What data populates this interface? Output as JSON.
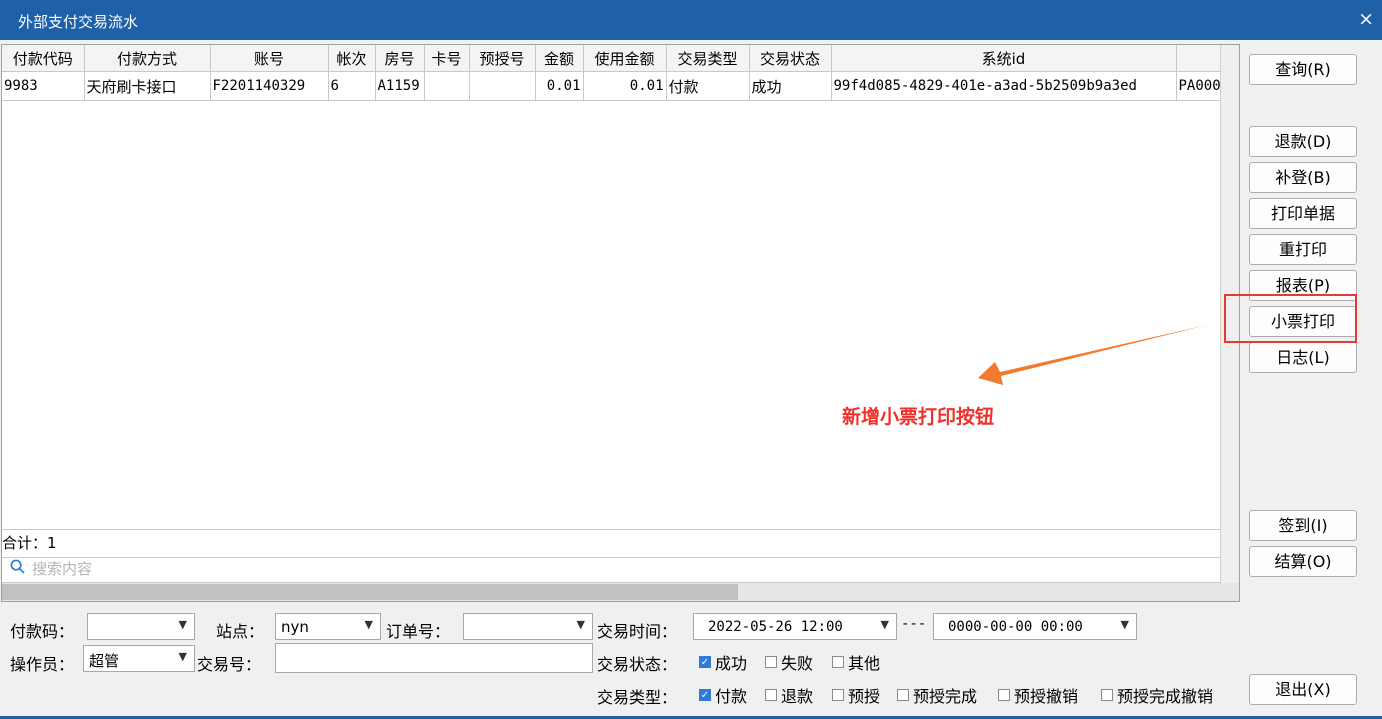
{
  "window": {
    "title": "外部支付交易流水",
    "close_glyph": "×"
  },
  "table": {
    "columns": [
      "付款代码",
      "付款方式",
      "账号",
      "帐次",
      "房号",
      "卡号",
      "预授号",
      "金额",
      "使用金额",
      "交易类型",
      "交易状态",
      "系统id",
      ""
    ],
    "rows": [
      [
        "9983",
        "天府刷卡接口",
        "F2201140329",
        "6",
        "A1159",
        "",
        "",
        "0.01",
        "0.01",
        "付款",
        "成功",
        "99f4d085-4829-401e-a3ad-5b2509b9a3ed",
        "PA000"
      ]
    ],
    "total_label": "合计：1",
    "search_placeholder": "搜索内容",
    "search_icon": "search-icon"
  },
  "buttons": {
    "query": "查询(R)",
    "refund": "退款(D)",
    "supplement": "补登(B)",
    "print_receipt": "打印单据",
    "reprint": "重打印",
    "report": "报表(P)",
    "ticket_print": "小票打印",
    "log": "日志(L)",
    "sign_in": "签到(I)",
    "settle": "结算(O)",
    "exit": "退出(X)"
  },
  "annotation": {
    "text": "新增小票打印按钮",
    "color": "#f0312b"
  },
  "filters": {
    "pay_code_label": "付款码：",
    "pay_code_value": "",
    "station_label": "站点：",
    "station_value": "nyn",
    "order_label": "订单号：",
    "order_value": "",
    "time_label": "交易时间：",
    "time_from": "2022-05-26 12:00",
    "time_sep": "---",
    "time_to": "0000-00-00 00:00",
    "operator_label": "操作员：",
    "operator_value": "超管",
    "trans_no_label": "交易号：",
    "trans_no_value": "",
    "status_label": "交易状态：",
    "status_options": [
      {
        "label": "成功",
        "checked": true
      },
      {
        "label": "失败",
        "checked": false
      },
      {
        "label": "其他",
        "checked": false
      }
    ],
    "type_label": "交易类型：",
    "type_options": [
      {
        "label": "付款",
        "checked": true
      },
      {
        "label": "退款",
        "checked": false
      },
      {
        "label": "预授",
        "checked": false
      },
      {
        "label": "预授完成",
        "checked": false
      },
      {
        "label": "预授撤销",
        "checked": false
      },
      {
        "label": "预授完成撤销",
        "checked": false
      }
    ]
  },
  "colors": {
    "titlebar": "#1f61a8",
    "highlight": "#e53935",
    "accent": "#2e7bd6"
  }
}
